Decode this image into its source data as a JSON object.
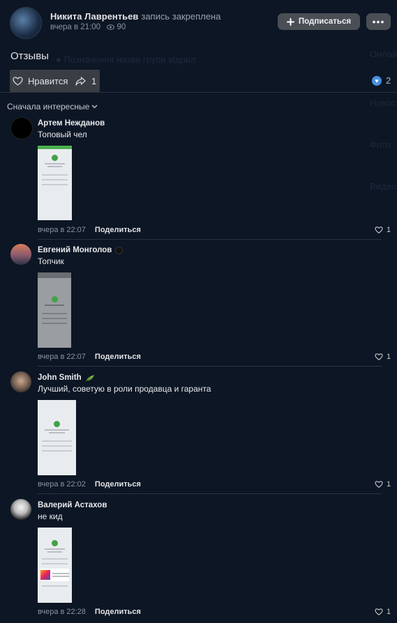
{
  "post": {
    "author": "Никита Лаврентьев",
    "pinned_label": "запись закреплена",
    "time": "вчера в 21:00",
    "views": "90",
    "subscribe_label": "Подписаться",
    "more_label": "•••",
    "title": "Отзывы",
    "like_label": "Нравится",
    "share_count": "1",
    "likes_total": "2"
  },
  "sort_label": "Сначала интересные",
  "comments": [
    {
      "author": "Артем Нежданов",
      "text": "Топовый чел",
      "time": "вчера в 22:07",
      "share": "Поделиться",
      "likes": "1"
    },
    {
      "author": "Евгений Монголов",
      "text": "Топчик",
      "time": "вчера в 22:07",
      "share": "Поделиться",
      "likes": "1"
    },
    {
      "author": "John Smith",
      "text": "Лучший, советую в роли продавца и гаранта",
      "time": "вчера в 22:02",
      "share": "Поделиться",
      "likes": "1"
    },
    {
      "author": "Валерий Астахов",
      "text": "не кид",
      "time": "вчера в 22:28",
      "share": "Поделиться",
      "likes": "1"
    }
  ],
  "colors": {
    "background": "#0d1624",
    "accent": "#4a8fe0",
    "button": "#4a4f56"
  }
}
